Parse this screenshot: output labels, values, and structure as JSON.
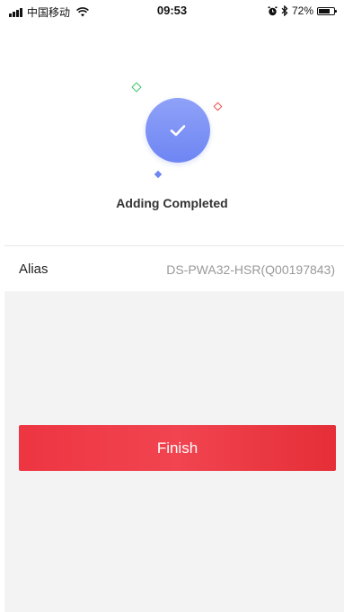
{
  "status_bar": {
    "carrier": "中国移动",
    "time": "09:53",
    "battery_percent": "72%",
    "battery_level": 0.72,
    "icons": [
      "signal-icon",
      "wifi-icon",
      "alarm-icon",
      "bluetooth-icon",
      "battery-icon"
    ]
  },
  "result": {
    "title": "Adding Completed",
    "icon": "checkmark-icon",
    "colors": {
      "circle": "#7b91f5",
      "green_accent": "#3cc46a",
      "red_accent": "#f05050",
      "blue_accent": "#6e86f3"
    }
  },
  "details": {
    "alias_label": "Alias",
    "alias_value": "DS-PWA32-HSR(Q00197843)"
  },
  "actions": {
    "finish_label": "Finish",
    "finish_color": "#ee3542"
  }
}
